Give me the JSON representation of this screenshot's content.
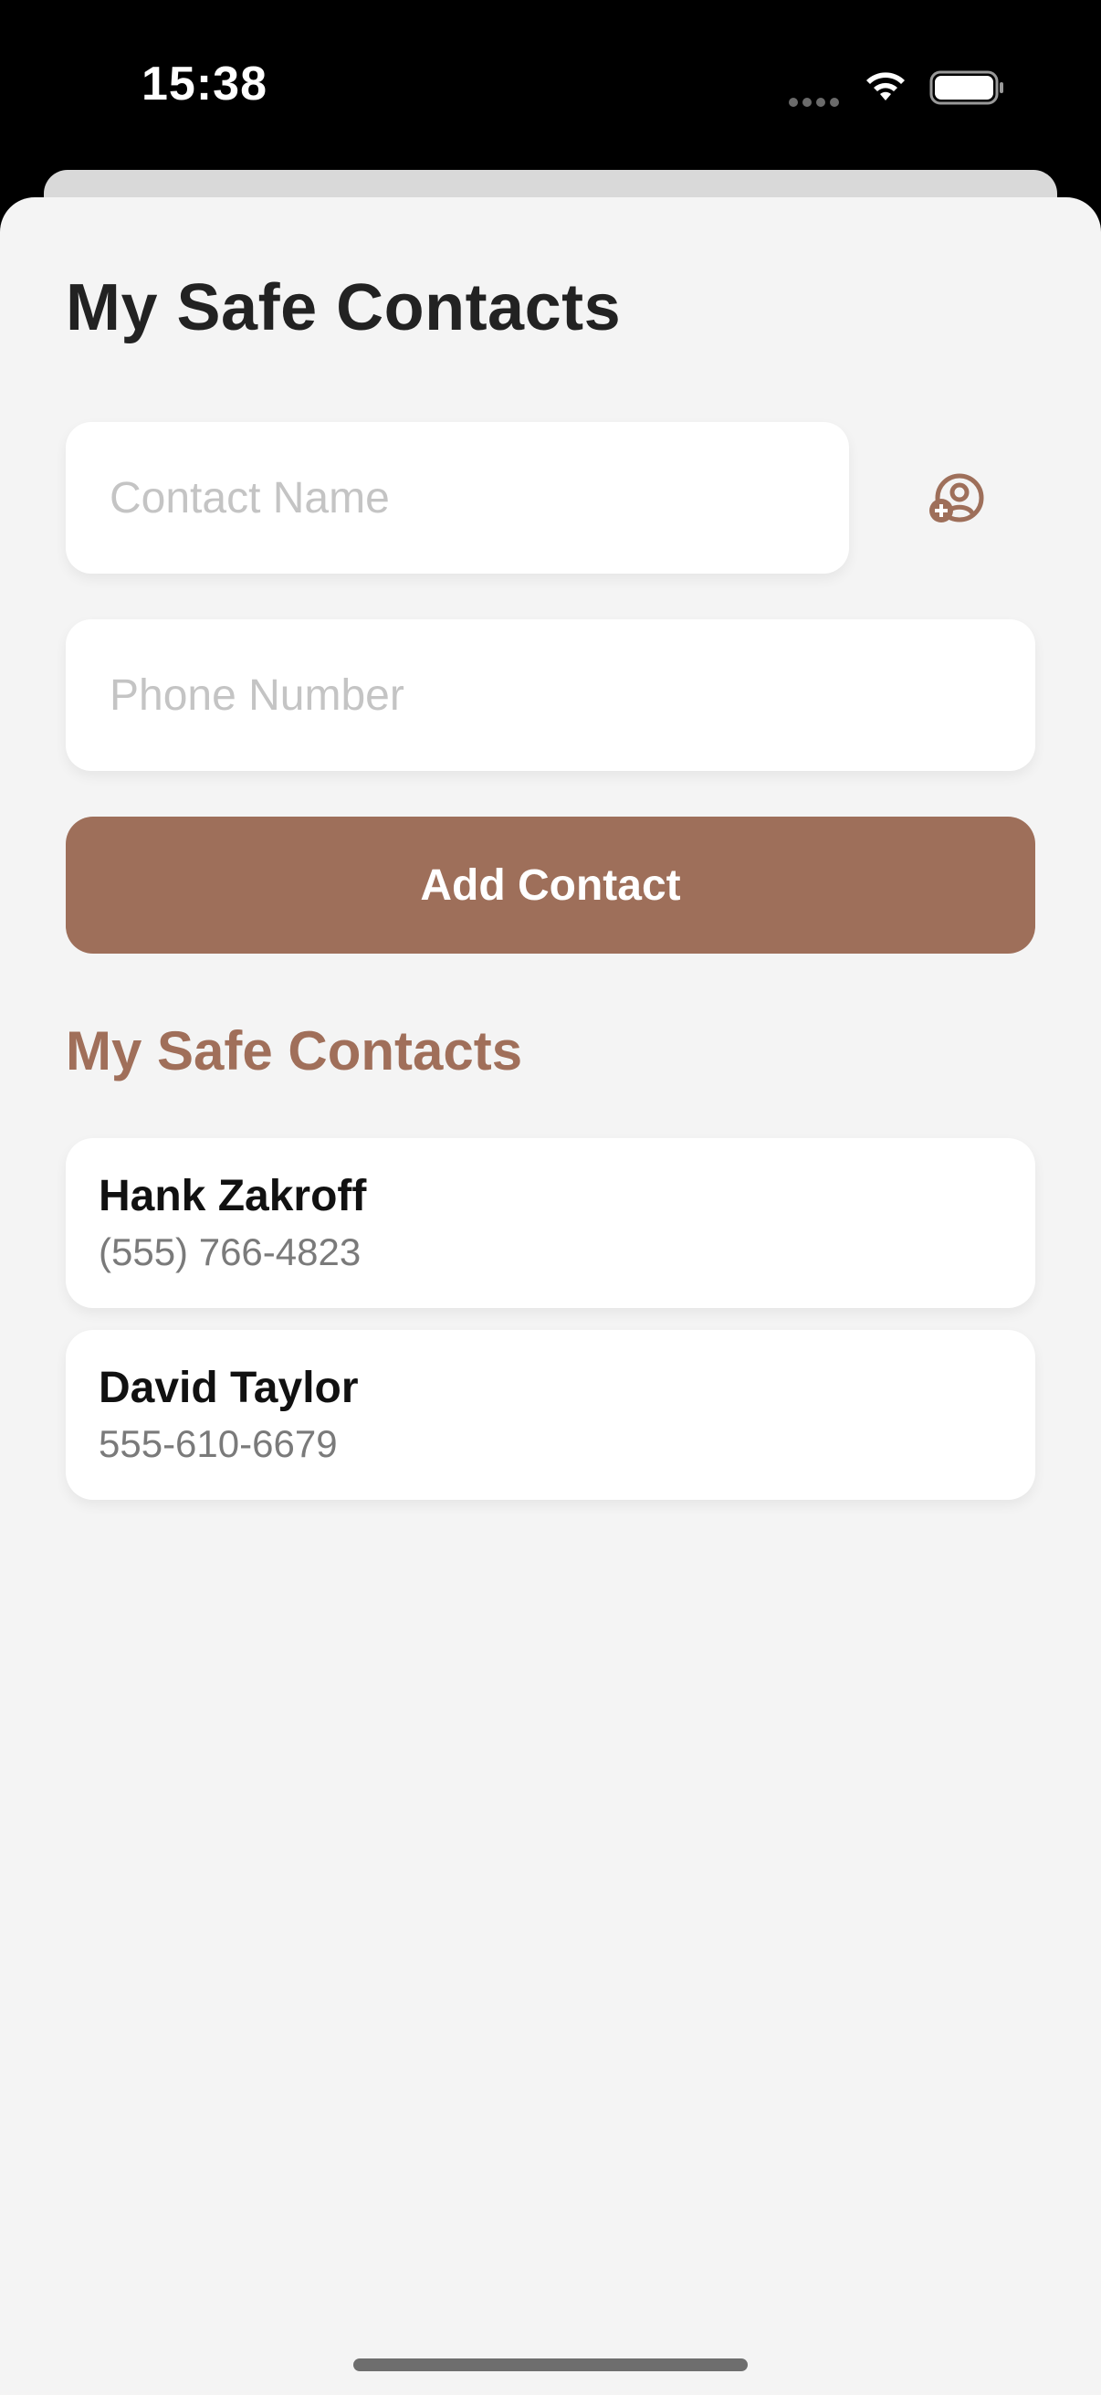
{
  "status_bar": {
    "time": "15:38",
    "icons": [
      "signal-dots-icon",
      "wifi-icon",
      "battery-icon"
    ]
  },
  "header": {
    "title": "My Safe Contacts"
  },
  "form": {
    "name_placeholder": "Contact Name",
    "name_value": "",
    "phone_placeholder": "Phone Number",
    "phone_value": "",
    "picker_icon": "add-person-icon",
    "add_button_label": "Add Contact"
  },
  "contacts_section": {
    "title": "My Safe Contacts",
    "items": [
      {
        "name": "Hank Zakroff",
        "phone": "(555) 766-4823"
      },
      {
        "name": "David Taylor",
        "phone": "555-610-6679"
      }
    ]
  },
  "colors": {
    "accent": "#9e6f5a",
    "background": "#f4f4f4",
    "card": "#ffffff",
    "title_text": "#222222",
    "secondary_text": "#7a7a7a",
    "placeholder_text": "#c4c4c4"
  }
}
